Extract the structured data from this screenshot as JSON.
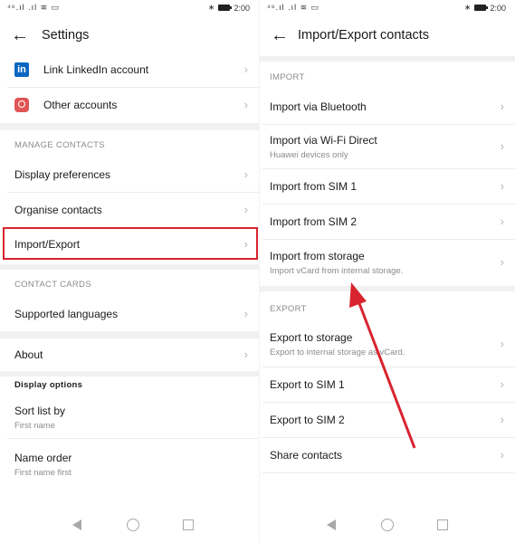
{
  "status_bar": {
    "signal": "⁴⁶.ıl .ıl ≋ ▭",
    "time": "2:00"
  },
  "settings": {
    "title": "Settings",
    "items_top": [
      {
        "label": "Link LinkedIn account",
        "icon": "linkedin-icon"
      },
      {
        "label": "Other accounts",
        "icon": "account-icon"
      }
    ],
    "manage_header": "MANAGE CONTACTS",
    "manage_items": [
      "Display preferences",
      "Organise contacts",
      "Import/Export"
    ],
    "cards_header": "CONTACT CARDS",
    "cards_items": [
      "Supported languages"
    ],
    "about": "About",
    "display_options_header": "Display options",
    "sort": {
      "label": "Sort list by",
      "value": "First name"
    },
    "name_order": {
      "label": "Name order",
      "value": "First name first"
    }
  },
  "import_export": {
    "title": "Import/Export contacts",
    "import_header": "IMPORT",
    "import_items": [
      {
        "label": "Import via Bluetooth",
        "sub": ""
      },
      {
        "label": "Import via Wi-Fi Direct",
        "sub": "Huawei devices only"
      },
      {
        "label": "Import from SIM 1",
        "sub": ""
      },
      {
        "label": "Import from SIM 2",
        "sub": ""
      },
      {
        "label": "Import from storage",
        "sub": "Import vCard from internal storage."
      }
    ],
    "export_header": "EXPORT",
    "export_items": [
      {
        "label": "Export to storage",
        "sub": "Export to internal storage as vCard."
      },
      {
        "label": "Export to SIM 1",
        "sub": ""
      },
      {
        "label": "Export to SIM 2",
        "sub": ""
      },
      {
        "label": "Share contacts",
        "sub": ""
      }
    ]
  },
  "colors": {
    "highlight": "#d8242f",
    "linkedin": "#0a66c2"
  }
}
